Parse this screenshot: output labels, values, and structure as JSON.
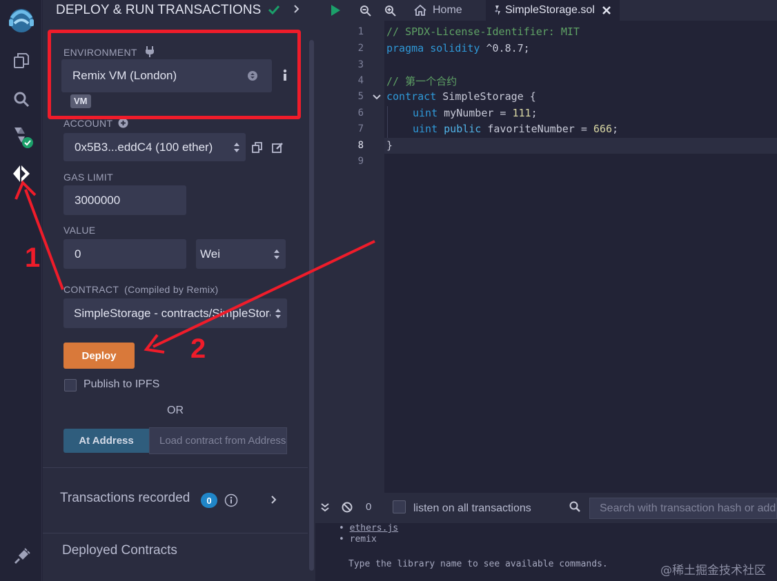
{
  "panel": {
    "title": "DEPLOY & RUN TRANSACTIONS",
    "environment": {
      "label": "ENVIRONMENT",
      "value": "Remix VM (London)",
      "badge": "VM"
    },
    "account": {
      "label": "ACCOUNT",
      "value": "0x5B3...eddC4 (100 ether)"
    },
    "gas_limit": {
      "label": "GAS LIMIT",
      "value": "3000000"
    },
    "value": {
      "label": "VALUE",
      "amount": "0",
      "unit": "Wei"
    },
    "contract": {
      "label": "CONTRACT",
      "sublabel": "(Compiled by Remix)",
      "value": "SimpleStorage - contracts/SimpleStorage.sol"
    },
    "deploy_label": "Deploy",
    "publish_label": "Publish to IPFS",
    "or_label": "OR",
    "at_address_label": "At Address",
    "load_placeholder": "Load contract from Address",
    "transactions_label": "Transactions recorded",
    "transactions_count": "0",
    "deployed_label": "Deployed Contracts"
  },
  "editor": {
    "home_tab": "Home",
    "file_tab": "SimpleStorage.sol",
    "line_numbers": [
      "1",
      "2",
      "3",
      "4",
      "5",
      "6",
      "7",
      "8",
      "9"
    ],
    "lines": {
      "l1": "// SPDX-License-Identifier: MIT",
      "l2_kw": "pragma solidity",
      "l2_rest": " ^0.8.7;",
      "l4": "// 第一个合约",
      "l5_kw": "contract",
      "l5_rest": " SimpleStorage {",
      "l6_kw": "uint",
      "l6_rest": " myNumber = ",
      "l6_num": "111",
      "l6_end": ";",
      "l7_kw": "uint",
      "l7_kw2": "public",
      "l7_rest": " favoriteNumber = ",
      "l7_num": "666",
      "l7_end": ";",
      "l8": "}"
    }
  },
  "terminal": {
    "count": "0",
    "listen_label": "listen on all transactions",
    "search_placeholder": "Search with transaction hash or address",
    "items": [
      "ethers.js",
      "remix"
    ],
    "hint": "Type the library name to see available commands."
  },
  "annotations": {
    "arrow1": "1",
    "arrow2": "2"
  },
  "watermark": "@稀土掘金技术社区",
  "colors": {
    "accent_red": "#ef1c2a",
    "deploy_orange": "#d9793a",
    "at_address": "#2f5d7d",
    "green_check": "#1ba06a"
  }
}
